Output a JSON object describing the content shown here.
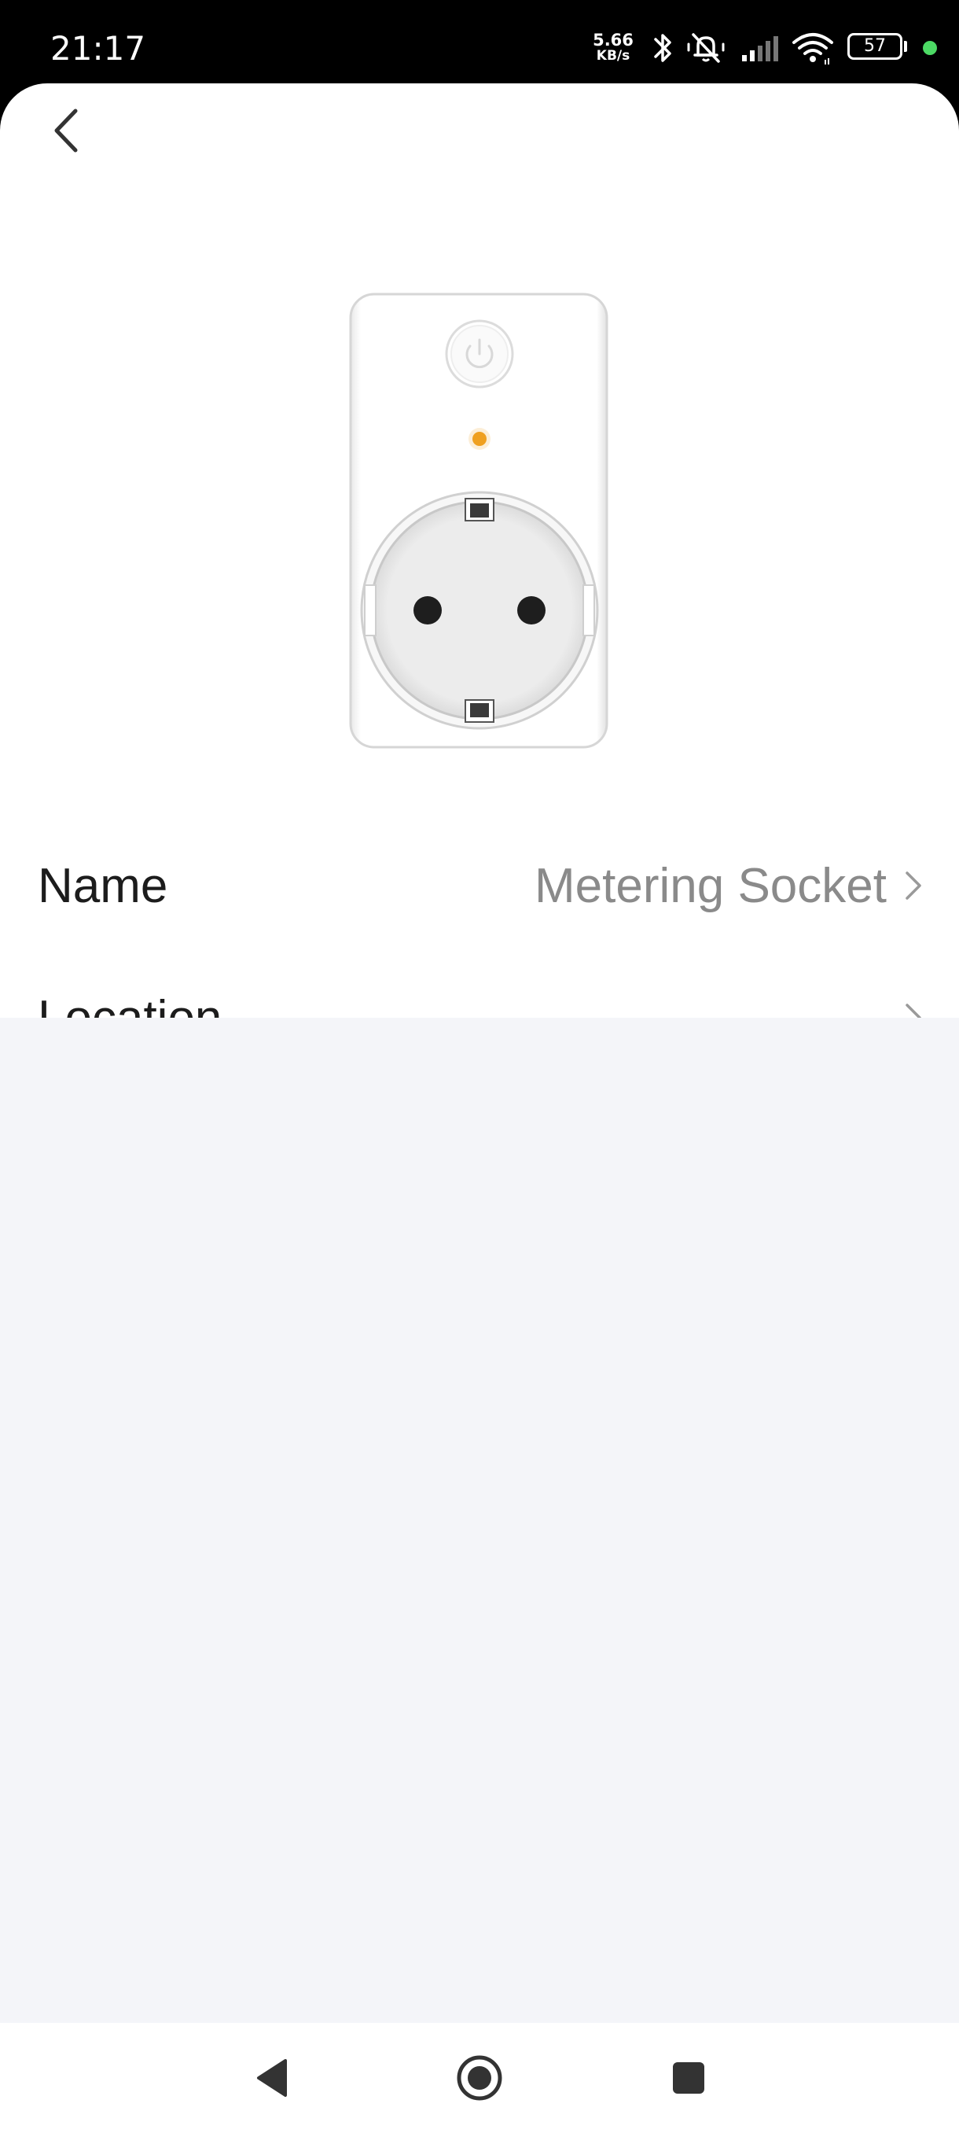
{
  "status_bar": {
    "time": "21:17",
    "net_speed_value": "5.66",
    "net_speed_unit": "KB/s",
    "battery": "57",
    "icons": [
      "bluetooth-icon",
      "mute-icon",
      "signal-icon",
      "wifi-icon",
      "battery-icon",
      "dot-indicator-icon"
    ],
    "dot_color": "#4cd964"
  },
  "header": {
    "back_icon": "chevron-left-icon"
  },
  "device": {
    "image": "smart-plug-illustration",
    "led_color": "#f0a020"
  },
  "settings": {
    "rows": [
      {
        "label": "Name",
        "value": "Metering Socket"
      },
      {
        "label": "Location",
        "value": ""
      }
    ]
  },
  "nav_bar": {
    "buttons": [
      "back-triangle-icon",
      "home-circle-icon",
      "recents-square-icon"
    ]
  },
  "colors": {
    "background_grey": "#f4f5f9",
    "label_text": "#1c1c1c",
    "value_text": "#8a8a8a"
  }
}
